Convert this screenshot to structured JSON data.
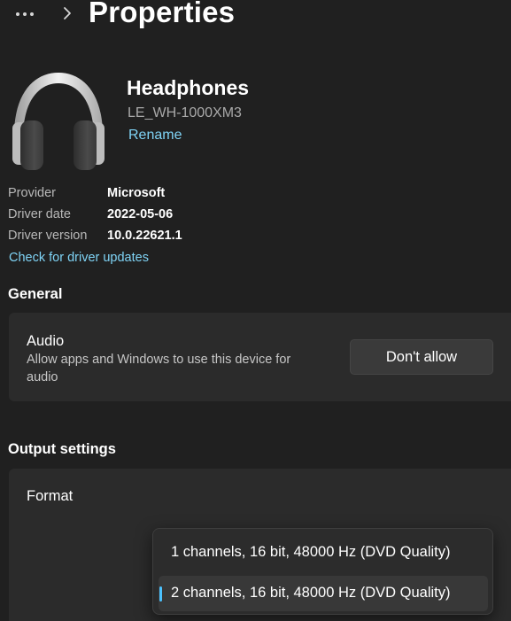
{
  "header": {
    "more_icon": "more-icon",
    "chevron_icon": "chevron-right-icon",
    "title": "Properties"
  },
  "device": {
    "icon": "headphones-icon",
    "name": "Headphones",
    "model": "LE_WH-1000XM3",
    "rename_label": "Rename"
  },
  "driver": {
    "rows": [
      {
        "label": "Provider",
        "value": "Microsoft"
      },
      {
        "label": "Driver date",
        "value": "2022-05-06"
      },
      {
        "label": "Driver version",
        "value": "10.0.22621.1"
      }
    ],
    "update_link": "Check for driver updates"
  },
  "general": {
    "header": "General",
    "audio": {
      "title": "Audio",
      "description": "Allow apps and Windows to use this device for audio",
      "button_label": "Don't allow"
    }
  },
  "output": {
    "header": "Output settings",
    "format": {
      "label": "Format",
      "options": [
        {
          "label": "1 channels, 16 bit, 48000 Hz (DVD Quality)",
          "selected": false
        },
        {
          "label": "2 channels, 16 bit, 48000 Hz (DVD Quality)",
          "selected": true
        }
      ]
    }
  },
  "colors": {
    "background": "#202020",
    "card": "#2b2b2b",
    "link": "#7fd3f5",
    "accent": "#4cc2ff"
  }
}
